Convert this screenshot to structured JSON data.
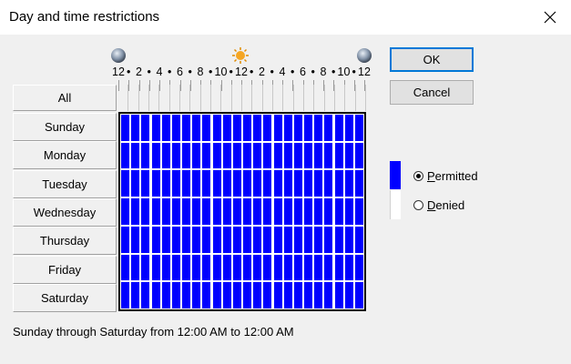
{
  "window": {
    "title": "Day and time restrictions",
    "close_icon": "close-icon"
  },
  "time_header": {
    "labels": [
      "12",
      "2",
      "4",
      "6",
      "8",
      "10",
      "12",
      "2",
      "4",
      "6",
      "8",
      "10",
      "12"
    ],
    "separator": "•",
    "icons": [
      "moon-icon",
      "sun-icon",
      "moon-icon"
    ]
  },
  "grid": {
    "all_label": "All",
    "days": [
      "Sunday",
      "Monday",
      "Tuesday",
      "Wednesday",
      "Thursday",
      "Friday",
      "Saturday"
    ],
    "hours_per_day": 24,
    "permitted_color": "#0000ff",
    "denied_color": "#ffffff"
  },
  "buttons": {
    "ok": "OK",
    "cancel": "Cancel"
  },
  "legend": {
    "permitted": "Permitted",
    "denied": "Denied",
    "selected": "permitted"
  },
  "status_text": "Sunday through Saturday from 12:00 AM to 12:00 AM"
}
